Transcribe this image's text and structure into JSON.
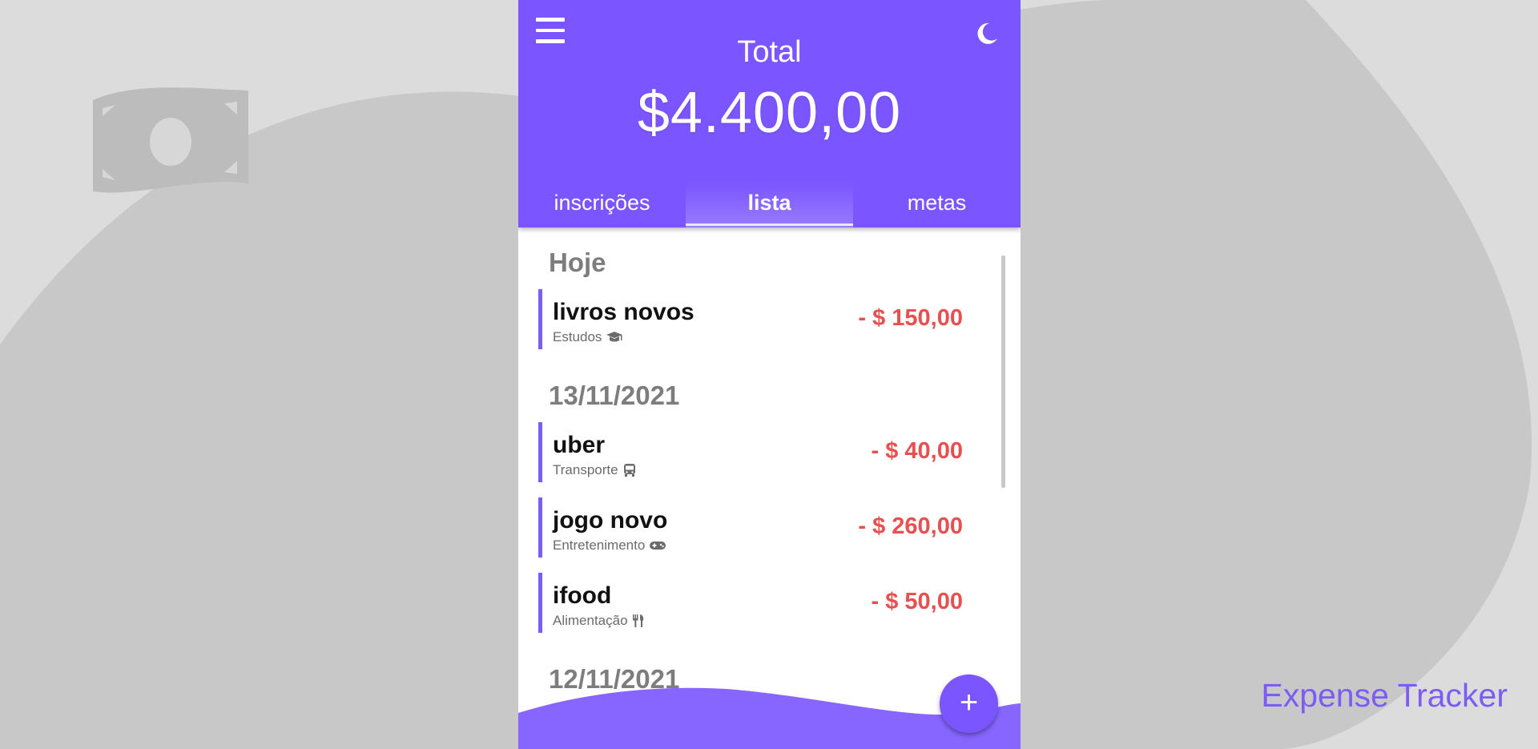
{
  "app_title": "Expense Tracker",
  "header": {
    "total_label": "Total",
    "total_value": "$4.400,00",
    "menu_icon": "hamburger-menu-icon",
    "theme_icon": "moon-icon"
  },
  "tabs": [
    {
      "label": "inscrições",
      "active": false
    },
    {
      "label": "lista",
      "active": true
    },
    {
      "label": "metas",
      "active": false
    }
  ],
  "groups": [
    {
      "date": "Hoje",
      "items": [
        {
          "name": "livros novos",
          "category": "Estudos",
          "icon": "graduation-cap-icon",
          "amount": "- $ 150,00"
        }
      ]
    },
    {
      "date": "13/11/2021",
      "items": [
        {
          "name": "uber",
          "category": "Transporte",
          "icon": "bus-icon",
          "amount": "- $ 40,00"
        },
        {
          "name": "jogo novo",
          "category": "Entretenimento",
          "icon": "gamepad-icon",
          "amount": "- $ 260,00"
        },
        {
          "name": "ifood",
          "category": "Alimentação",
          "icon": "utensils-icon",
          "amount": "- $ 50,00"
        }
      ]
    },
    {
      "date": "12/11/2021",
      "items": []
    }
  ],
  "fab_label": "+",
  "colors": {
    "primary": "#7b55ff",
    "expense": "#e94f4f",
    "brand_text": "#7b5cf5",
    "background": "#dddcdd"
  }
}
